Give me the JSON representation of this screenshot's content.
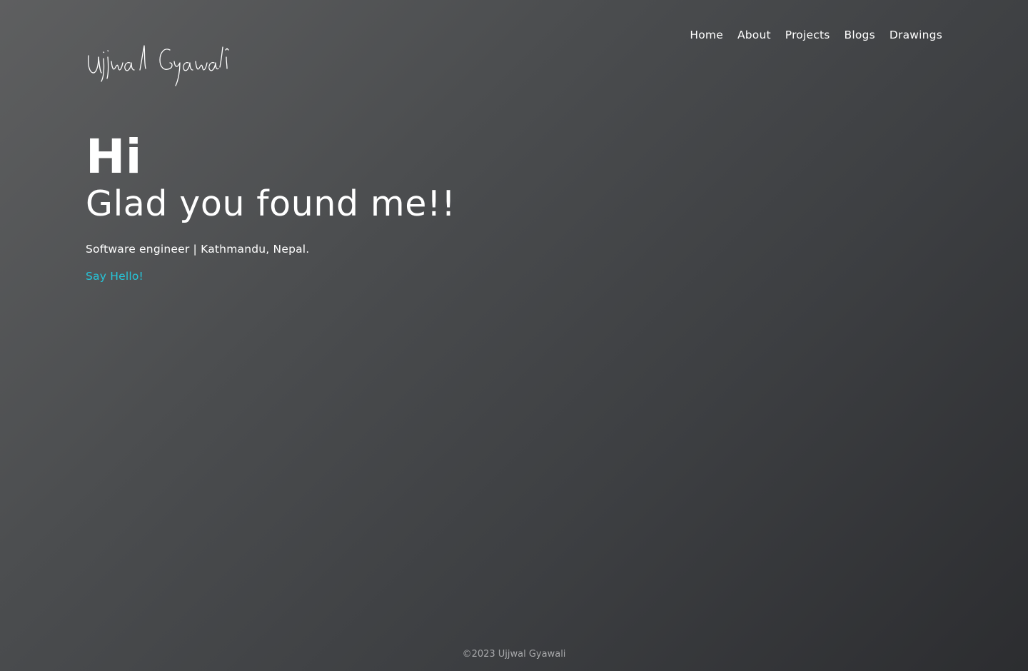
{
  "header": {
    "logo_text": "Ujjwal Gyawali",
    "nav": [
      {
        "label": "Home"
      },
      {
        "label": "About"
      },
      {
        "label": "Projects"
      },
      {
        "label": "Blogs"
      },
      {
        "label": "Drawings"
      }
    ]
  },
  "hero": {
    "greeting": "Hi",
    "headline": "Glad you found me!!",
    "tagline": "Software engineer | Kathmandu, Nepal.",
    "cta_label": "Say Hello!"
  },
  "footer": {
    "copyright": "©2023 Ujjwal Gyawali"
  },
  "colors": {
    "accent": "#26c6da",
    "text": "#ffffff",
    "footer_text": "#a8a9ab"
  }
}
